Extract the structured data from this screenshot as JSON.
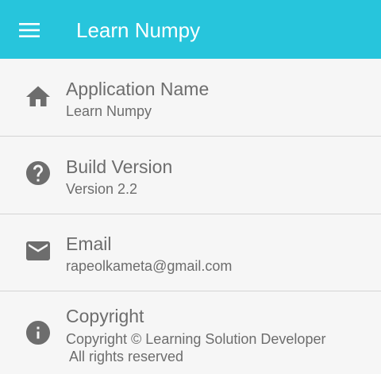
{
  "appbar": {
    "title": "Learn Numpy",
    "menu_icon": "hamburger-menu-icon",
    "background": "#27c5dc"
  },
  "info_items": [
    {
      "icon": "home-icon",
      "title": "Application Name",
      "value": "Learn Numpy"
    },
    {
      "icon": "help-circle-icon",
      "title": "Build Version",
      "value": "Version 2.2"
    },
    {
      "icon": "mail-icon",
      "title": "Email",
      "value": "rapeolkameta@gmail.com"
    },
    {
      "icon": "info-circle-icon",
      "title": "Copyright",
      "value": "Copyright © Learning Solution Developer",
      "value_line2": " All rights reserved"
    }
  ],
  "colors": {
    "text": "#6d6d6d",
    "icon": "#6d6d6d",
    "divider": "#d4d4d4",
    "background": "#f6f6f6"
  }
}
